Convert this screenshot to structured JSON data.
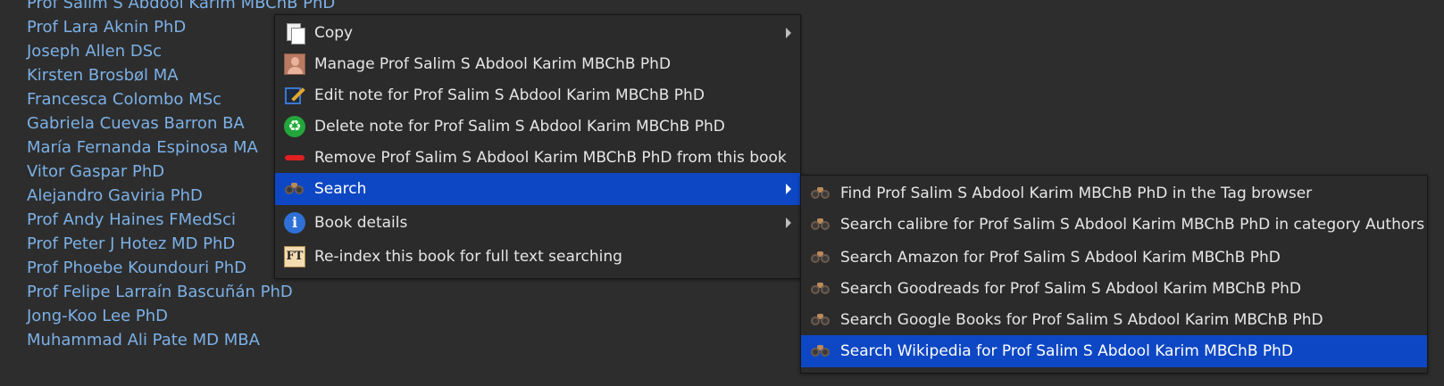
{
  "authors": [
    "Prof Salim S Abdool Karim MBChB PhD",
    "Prof Lara Aknin PhD",
    "Joseph Allen DSc",
    "Kirsten Brosbøl MA",
    "Francesca Colombo MSc",
    "Gabriela Cuevas Barron BA",
    "María Fernanda Espinosa MA",
    "Vitor Gaspar PhD",
    "Alejandro Gaviria PhD",
    "Prof Andy Haines FMedSci",
    "Prof Peter J Hotez MD PhD",
    "Prof Phoebe Koundouri PhD",
    "Prof Felipe Larraín Bascuñán PhD",
    "Jong-Koo Lee PhD",
    "Muhammad Ali Pate MD MBA"
  ],
  "context_menu": {
    "items": [
      {
        "label": "Copy",
        "icon": "copy-icon",
        "has_submenu": true
      },
      {
        "label": "Manage Prof Salim S Abdool Karim MBChB PhD",
        "icon": "user-icon",
        "has_submenu": false
      },
      {
        "label": "Edit note for Prof Salim S Abdool Karim MBChB PhD",
        "icon": "edit-note-icon",
        "has_submenu": false
      },
      {
        "label": "Delete note for Prof Salim S Abdool Karim MBChB PhD",
        "icon": "recycle-icon",
        "has_submenu": false
      },
      {
        "label": "Remove Prof Salim S Abdool Karim MBChB PhD from this book",
        "icon": "remove-icon",
        "has_submenu": false
      },
      {
        "label": "Search",
        "icon": "binoculars-icon",
        "has_submenu": true,
        "active": true
      },
      {
        "label": "Book details",
        "icon": "info-icon",
        "has_submenu": true
      },
      {
        "label": "Re-index this book for full text searching",
        "icon": "full-text-icon",
        "has_submenu": false
      }
    ]
  },
  "search_submenu": {
    "items": [
      {
        "label": "Find Prof Salim S Abdool Karim MBChB PhD in the Tag browser",
        "icon": "binoculars-icon"
      },
      {
        "label": "Search calibre for Prof Salim S Abdool Karim MBChB PhD in category Authors",
        "icon": "binoculars-icon"
      },
      {
        "label": "Search Amazon for Prof Salim S Abdool Karim MBChB PhD",
        "icon": "binoculars-icon"
      },
      {
        "label": "Search Goodreads for Prof Salim S Abdool Karim MBChB PhD",
        "icon": "binoculars-icon"
      },
      {
        "label": "Search Google Books for Prof Salim S Abdool Karim MBChB PhD",
        "icon": "binoculars-icon"
      },
      {
        "label": "Search Wikipedia for Prof Salim S Abdool Karim MBChB PhD",
        "icon": "binoculars-icon",
        "active": true
      }
    ]
  },
  "colors": {
    "background": "#2d2d2d",
    "link": "#7cb0e6",
    "menu_bg": "#2b2b2b",
    "highlight": "#0d47c4",
    "menu_text": "#e6e6e6"
  },
  "icon_glyphs": {
    "recycle": "♻",
    "info": "i",
    "full_text": "FT"
  }
}
